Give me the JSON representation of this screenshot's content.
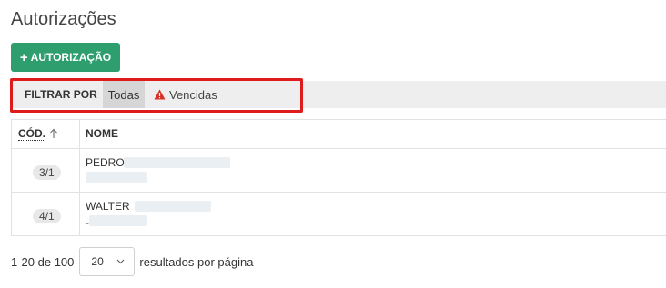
{
  "page": {
    "title": "Autorizações"
  },
  "actions": {
    "add_label": "AUTORIZAÇÃO",
    "add_icon": "plus-icon",
    "accent": "#2e9e6e"
  },
  "filter": {
    "label": "FILTRAR POR",
    "options": [
      {
        "label": "Todas",
        "selected": true
      },
      {
        "label": "Vencidas",
        "icon": "warning-icon",
        "icon_color": "#d93025"
      }
    ],
    "highlight_color": "#e01b1b"
  },
  "table": {
    "columns": [
      {
        "label": "CÓD.",
        "sort": "ascending",
        "sort_icon": "arrow-up-icon"
      },
      {
        "label": "NOME"
      }
    ],
    "rows": [
      {
        "code": "3/1",
        "name": "PEDRO",
        "subline": ""
      },
      {
        "code": "4/1",
        "name": "WALTER",
        "subline": "-"
      }
    ]
  },
  "pagination": {
    "range": "1-20 de 100",
    "page_size": "20",
    "suffix": "resultados por página",
    "chevron_icon": "chevron-down-icon"
  }
}
